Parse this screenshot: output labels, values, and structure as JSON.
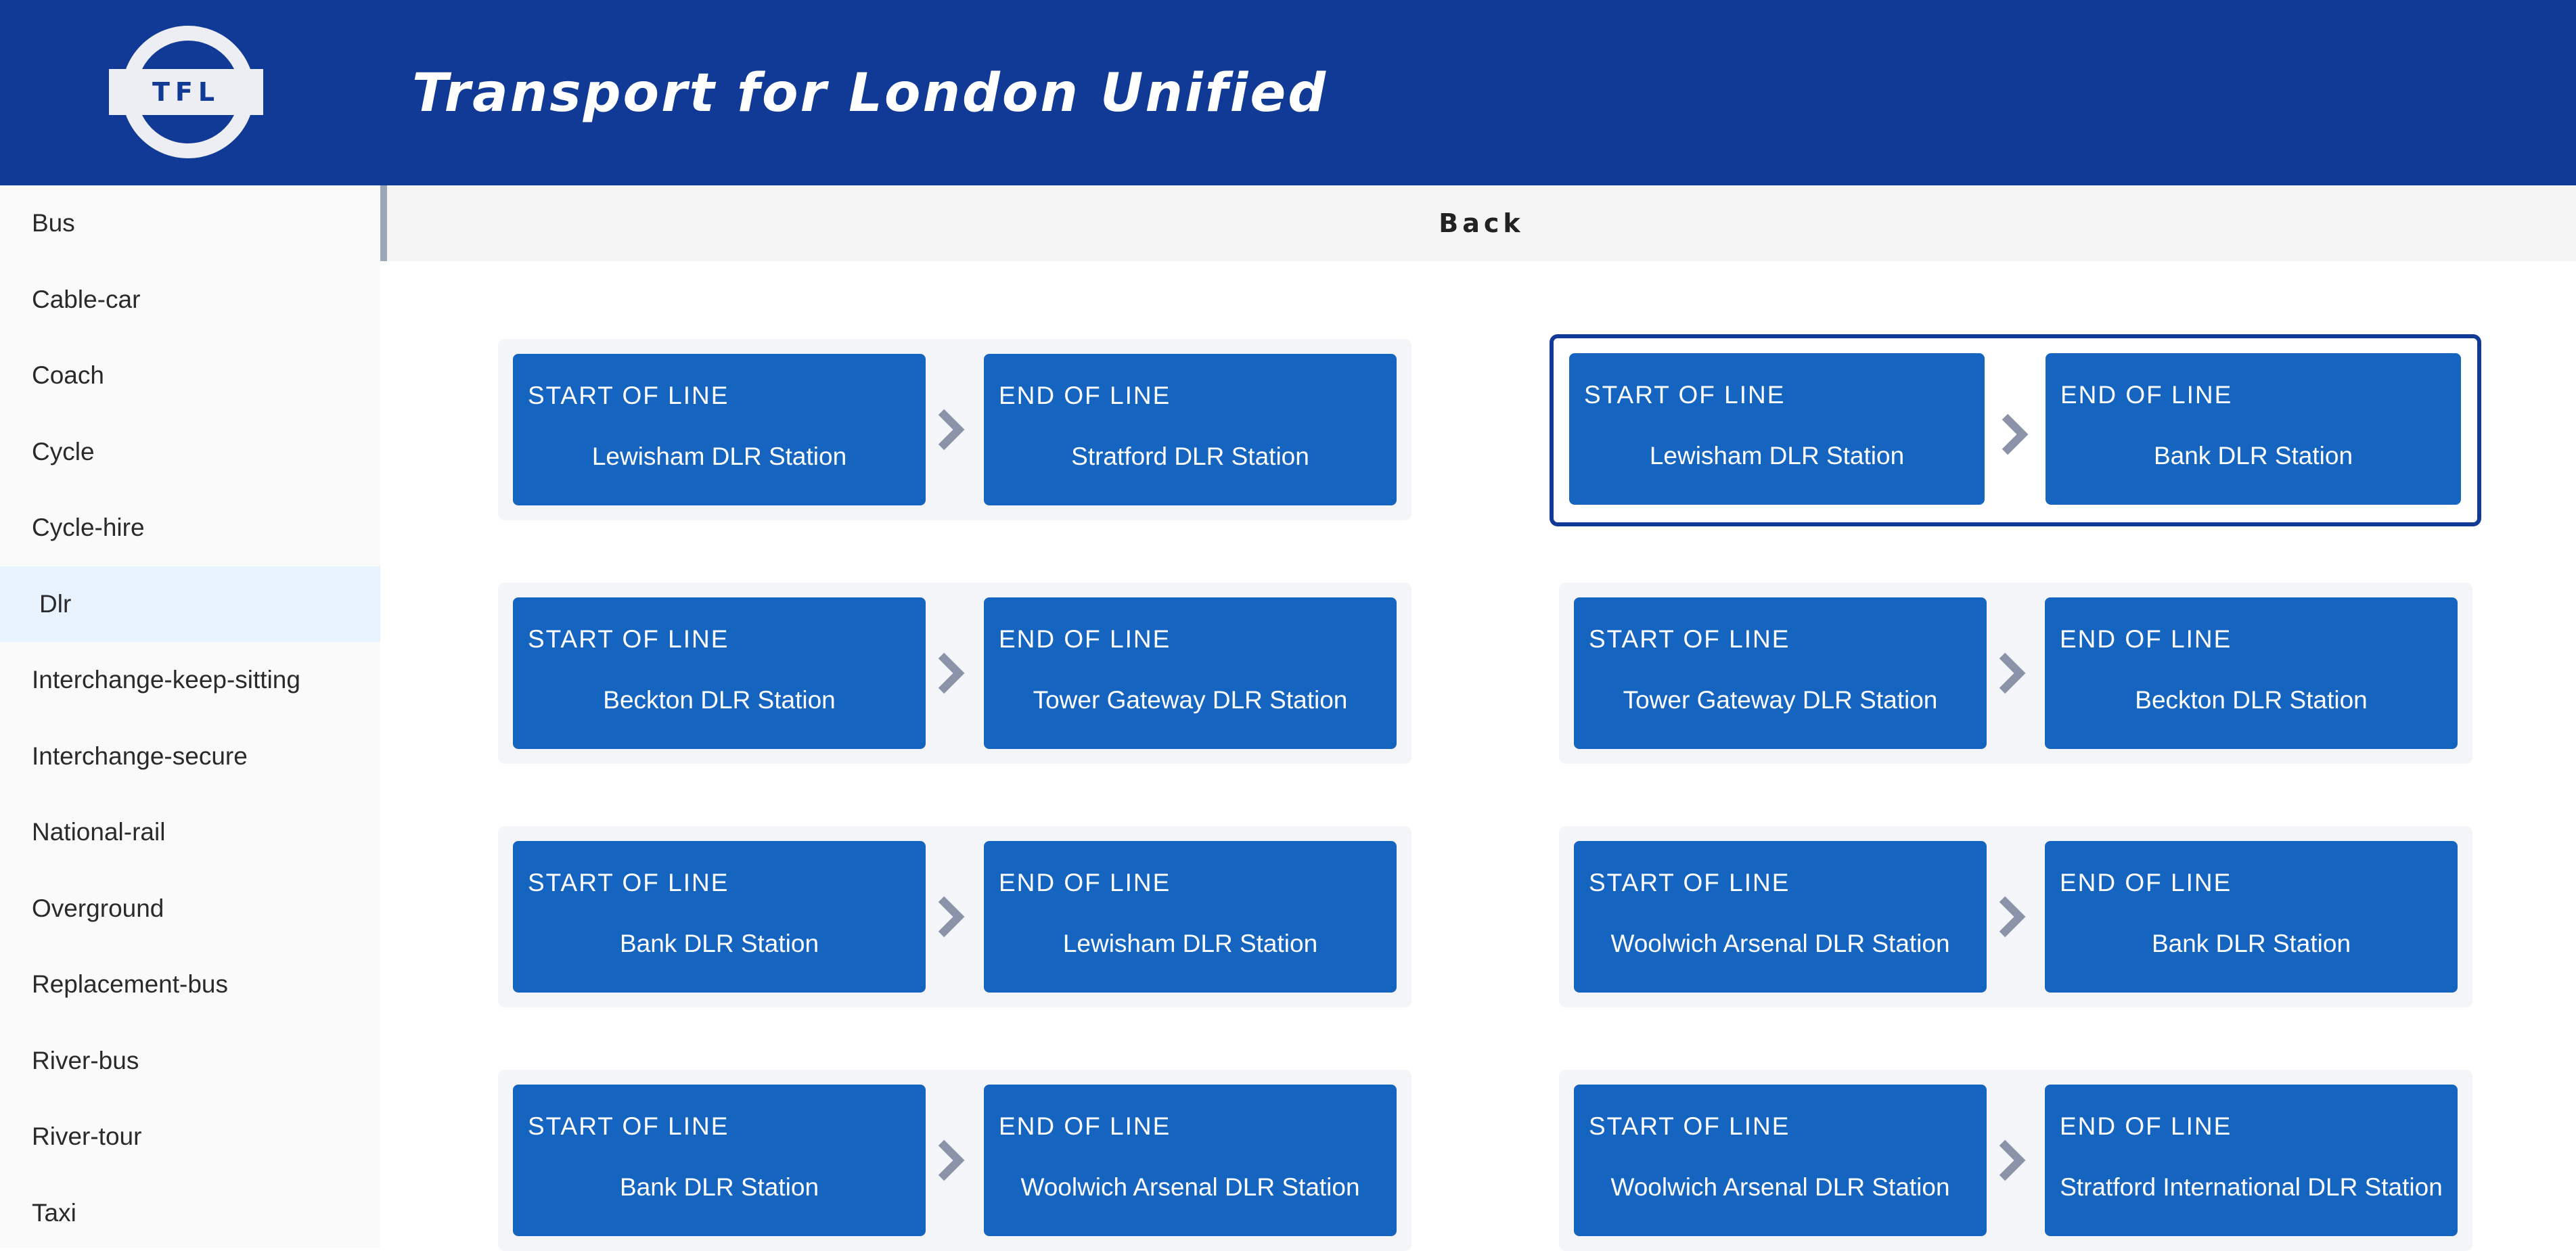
{
  "header": {
    "logo_text": "TFL",
    "title": "Transport for London Unified"
  },
  "sidebar": {
    "items": [
      {
        "label": "Bus"
      },
      {
        "label": "Cable-car"
      },
      {
        "label": "Coach"
      },
      {
        "label": "Cycle"
      },
      {
        "label": "Cycle-hire"
      },
      {
        "label": "Dlr",
        "active": true
      },
      {
        "label": "Interchange-keep-sitting"
      },
      {
        "label": "Interchange-secure"
      },
      {
        "label": "National-rail"
      },
      {
        "label": "Overground"
      },
      {
        "label": "Replacement-bus"
      },
      {
        "label": "River-bus"
      },
      {
        "label": "River-tour"
      },
      {
        "label": "Taxi"
      }
    ]
  },
  "back_label": "Back",
  "colors": {
    "header_bg": "#113a96",
    "station_box": "#1565c0",
    "active_sidebar_bg": "#e8f3fd",
    "selected_border": "#113a96",
    "arrow": "#8a93a8"
  },
  "routes": [
    {
      "start_caption": "START OF LINE",
      "start": "Lewisham DLR Station",
      "end_caption": "END OF LINE",
      "end": "Stratford DLR Station"
    },
    {
      "start_caption": "START OF LINE",
      "start": "Lewisham DLR Station",
      "end_caption": "END OF LINE",
      "end": "Bank DLR Station",
      "selected": true
    },
    {
      "start_caption": "START OF LINE",
      "start": "Beckton DLR Station",
      "end_caption": "END OF LINE",
      "end": "Tower Gateway DLR Station"
    },
    {
      "start_caption": "START OF LINE",
      "start": "Tower Gateway DLR Station",
      "end_caption": "END OF LINE",
      "end": "Beckton DLR Station"
    },
    {
      "start_caption": "START OF LINE",
      "start": "Bank DLR Station",
      "end_caption": "END OF LINE",
      "end": "Lewisham DLR Station"
    },
    {
      "start_caption": "START OF LINE",
      "start": "Woolwich Arsenal DLR Station",
      "end_caption": "END OF LINE",
      "end": "Bank DLR Station"
    },
    {
      "start_caption": "START OF LINE",
      "start": "Bank DLR Station",
      "end_caption": "END OF LINE",
      "end": "Woolwich Arsenal DLR Station"
    },
    {
      "start_caption": "START OF LINE",
      "start": "Woolwich Arsenal DLR Station",
      "end_caption": "END OF LINE",
      "end": "Stratford International DLR Station"
    }
  ],
  "icons": {
    "logo": "tfl-roundel-icon",
    "route_separator": "chevron-right-icon"
  }
}
